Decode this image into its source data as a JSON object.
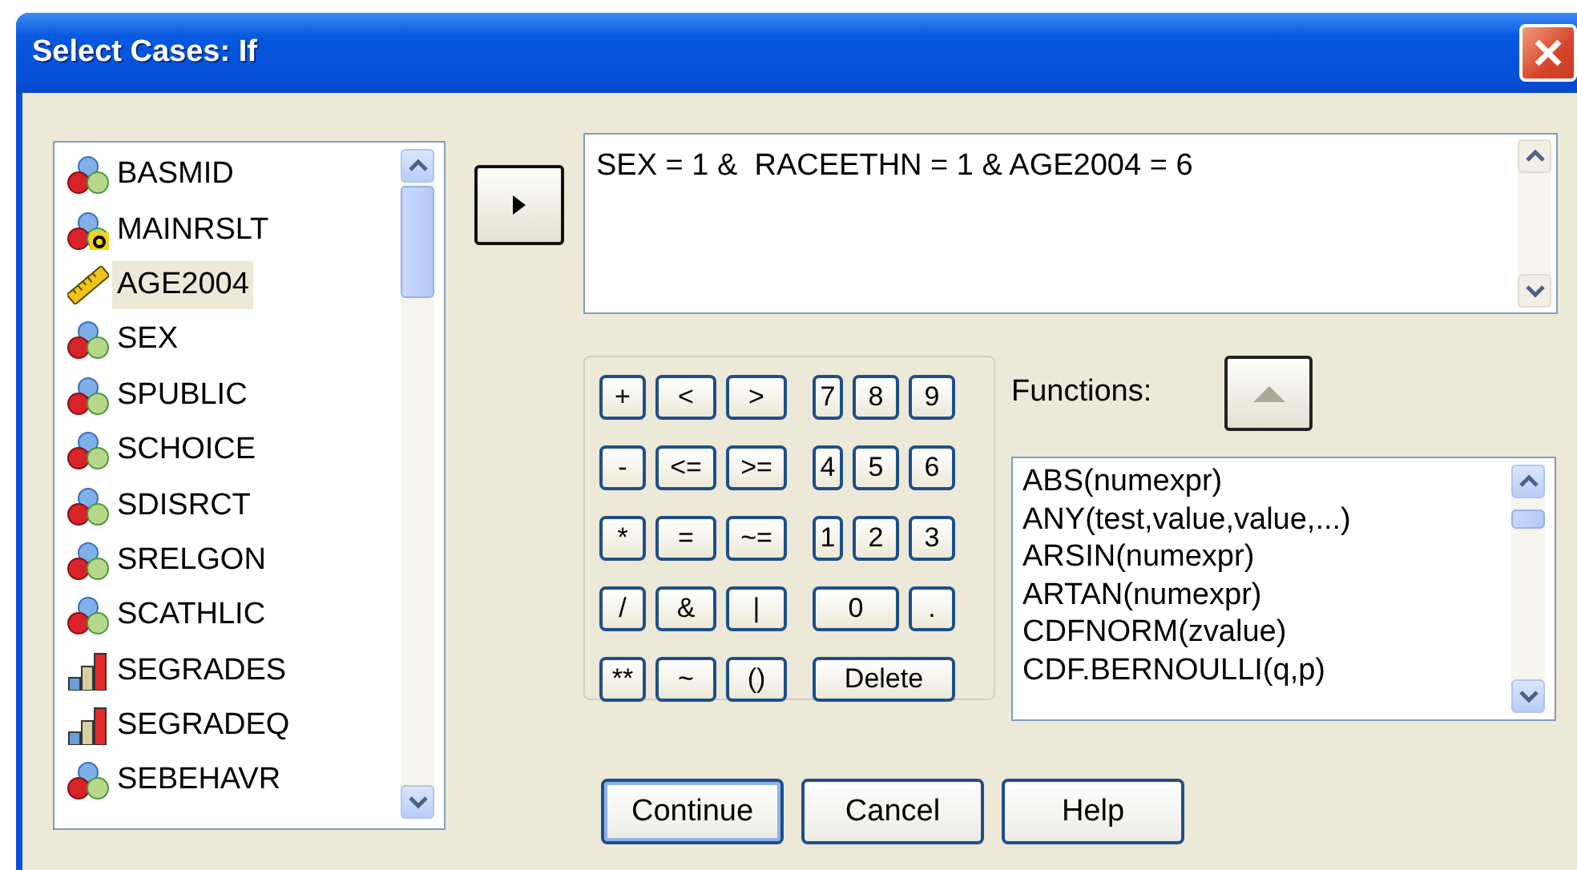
{
  "window": {
    "title": "Select Cases: If"
  },
  "variables": [
    {
      "name": "BASMID",
      "kind": "nominal",
      "selected": false
    },
    {
      "name": "MAINRSLT",
      "kind": "string",
      "selected": false
    },
    {
      "name": "AGE2004",
      "kind": "scale",
      "selected": true
    },
    {
      "name": "SEX",
      "kind": "nominal",
      "selected": false
    },
    {
      "name": "SPUBLIC",
      "kind": "nominal",
      "selected": false
    },
    {
      "name": "SCHOICE",
      "kind": "nominal",
      "selected": false
    },
    {
      "name": "SDISRCT",
      "kind": "nominal",
      "selected": false
    },
    {
      "name": "SRELGON",
      "kind": "nominal",
      "selected": false
    },
    {
      "name": "SCATHLIC",
      "kind": "nominal",
      "selected": false
    },
    {
      "name": "SEGRADES",
      "kind": "ordinal",
      "selected": false
    },
    {
      "name": "SEGRADEQ",
      "kind": "ordinal",
      "selected": false
    },
    {
      "name": "SEBEHAVR",
      "kind": "nominal",
      "selected": false
    }
  ],
  "expression": {
    "value": "SEX = 1 &  RACEETHN = 1 & AGE2004 = 6"
  },
  "calculator": {
    "keys": [
      {
        "label": "+",
        "kind": "op"
      },
      {
        "label": "<",
        "kind": "op"
      },
      {
        "label": ">",
        "kind": "op"
      },
      {
        "label": "7",
        "kind": "digit"
      },
      {
        "label": "8",
        "kind": "digit"
      },
      {
        "label": "9",
        "kind": "digit"
      },
      {
        "label": "-",
        "kind": "op"
      },
      {
        "label": "<=",
        "kind": "op"
      },
      {
        "label": ">=",
        "kind": "op"
      },
      {
        "label": "4",
        "kind": "digit"
      },
      {
        "label": "5",
        "kind": "digit"
      },
      {
        "label": "6",
        "kind": "digit"
      },
      {
        "label": "*",
        "kind": "op"
      },
      {
        "label": "=",
        "kind": "op"
      },
      {
        "label": "~=",
        "kind": "op"
      },
      {
        "label": "1",
        "kind": "digit"
      },
      {
        "label": "2",
        "kind": "digit"
      },
      {
        "label": "3",
        "kind": "digit"
      },
      {
        "label": "/",
        "kind": "op"
      },
      {
        "label": "&",
        "kind": "op"
      },
      {
        "label": "|",
        "kind": "op"
      },
      {
        "label": "0",
        "kind": "wide_digit"
      },
      {
        "label": ".",
        "kind": "digit"
      },
      {
        "label": "**",
        "kind": "op"
      },
      {
        "label": "~",
        "kind": "op"
      },
      {
        "label": "()",
        "kind": "op"
      },
      {
        "label": "Delete",
        "kind": "delete"
      }
    ]
  },
  "functions": {
    "label": "Functions:",
    "items": [
      "ABS(numexpr)",
      "ANY(test,value,value,...)",
      "ARSIN(numexpr)",
      "ARTAN(numexpr)",
      "CDFNORM(zvalue)",
      "CDF.BERNOULLI(q,p)"
    ]
  },
  "buttons": [
    {
      "label": "Continue",
      "default": true
    },
    {
      "label": "Cancel",
      "default": false
    },
    {
      "label": "Help",
      "default": false
    }
  ]
}
